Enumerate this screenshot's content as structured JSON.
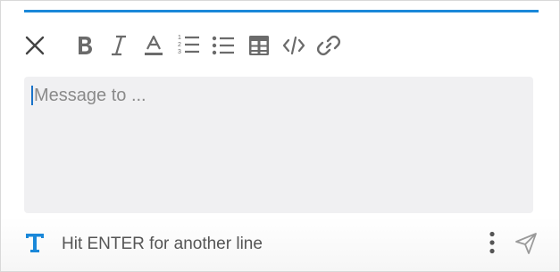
{
  "composer": {
    "placeholder": "Message to ...",
    "hint": "Hit ENTER for another line"
  },
  "toolbar": {
    "items": [
      {
        "name": "close",
        "icon": "close-icon"
      },
      {
        "name": "bold",
        "icon": "bold-icon"
      },
      {
        "name": "italic",
        "icon": "italic-icon"
      },
      {
        "name": "font-color",
        "icon": "font-color-icon"
      },
      {
        "name": "ordered-list",
        "icon": "ordered-list-icon",
        "digits": [
          "1",
          "2",
          "3"
        ]
      },
      {
        "name": "bullet-list",
        "icon": "bullet-list-icon"
      },
      {
        "name": "table",
        "icon": "table-icon"
      },
      {
        "name": "code",
        "icon": "code-icon"
      },
      {
        "name": "link",
        "icon": "link-icon"
      }
    ]
  },
  "footer": {
    "format_icon": "text-format-icon",
    "more_icon": "more-vertical-icon",
    "send_icon": "send-icon"
  },
  "colors": {
    "accent": "#1a88d9",
    "icon": "#6b6b6b",
    "editor_bg": "#f0f0f2",
    "format_icon": "#1a88d9"
  }
}
